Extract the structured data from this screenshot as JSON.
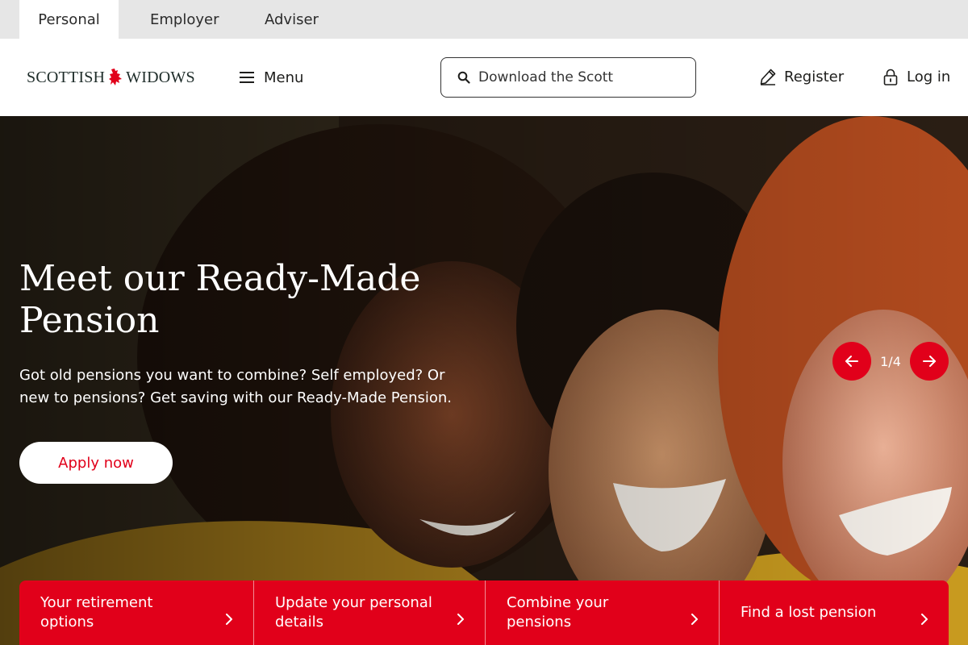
{
  "segments": {
    "personal": "Personal",
    "employer": "Employer",
    "adviser": "Adviser",
    "active": "Personal"
  },
  "header": {
    "logo_left": "SCOTTISH",
    "logo_right": "WIDOWS",
    "menu_label": "Menu",
    "search_value": "Download the Scott",
    "register_label": "Register",
    "login_label": "Log in"
  },
  "hero": {
    "title": "Meet our Ready-Made Pension",
    "subtitle": "Got old pensions you want to combine? Self employed? Or new to pensions? Get saving with our Ready-Made Pension.",
    "cta_label": "Apply now",
    "carousel_counter": "1/4"
  },
  "quick_links": [
    {
      "label": "Your retirement options"
    },
    {
      "label": "Update your personal details"
    },
    {
      "label": "Combine your pensions"
    },
    {
      "label": "Find a lost pension"
    }
  ],
  "icons": {
    "menu": "hamburger-icon",
    "search": "search-icon",
    "register": "pencil-icon",
    "login": "padlock-icon",
    "prev": "arrow-left-icon",
    "next": "arrow-right-icon",
    "chevron": "chevron-right-icon",
    "logo_mark": "red-rider-icon"
  },
  "colors": {
    "brand_red": "#e1001a",
    "tab_bar_bg": "#e6e6e6",
    "logo_text": "#1e2c29"
  }
}
